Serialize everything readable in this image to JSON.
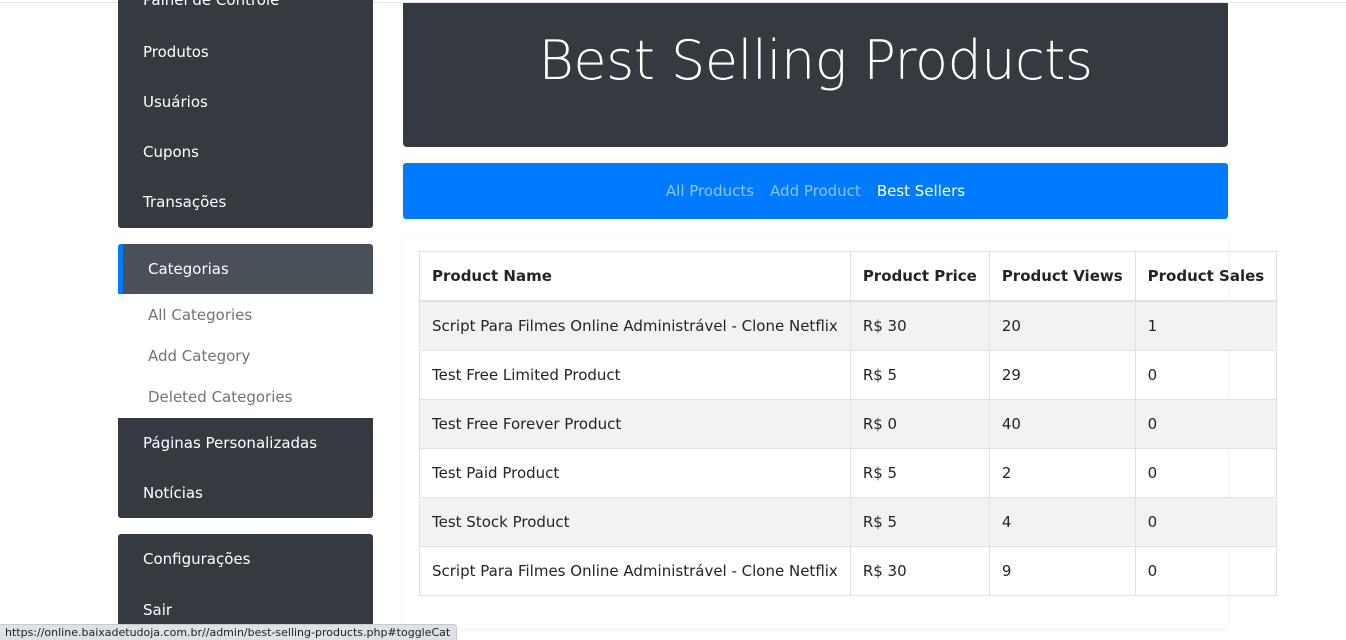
{
  "sidebar": {
    "top_items": [
      "Painel de Controle",
      "Produtos",
      "Usuários",
      "Cupons",
      "Transações"
    ],
    "active_section": "Categorias",
    "sub_items": [
      "All Categories",
      "Add Category",
      "Deleted Categories"
    ],
    "mid_items": [
      "Páginas Personalizadas",
      "Notícias"
    ],
    "bottom_items": [
      "Configurações",
      "Sair"
    ]
  },
  "header": {
    "title": "Best Selling Products"
  },
  "nav": {
    "links": [
      {
        "label": "All Products",
        "active": false
      },
      {
        "label": "Add Product",
        "active": false
      },
      {
        "label": "Best Sellers",
        "active": true
      }
    ]
  },
  "table": {
    "columns": [
      "Product Name",
      "Product Price",
      "Product Views",
      "Product Sales"
    ],
    "rows": [
      [
        "Script Para Filmes Online Administrável - Clone Netflix",
        "R$ 30",
        "20",
        "1"
      ],
      [
        "Test Free Limited Product",
        "R$ 5",
        "29",
        "0"
      ],
      [
        "Test Free Forever Product",
        "R$ 0",
        "40",
        "0"
      ],
      [
        "Test Paid Product",
        "R$ 5",
        "2",
        "0"
      ],
      [
        "Test Stock Product",
        "R$ 5",
        "4",
        "0"
      ],
      [
        "Script Para Filmes Online Administrável - Clone Netflix",
        "R$ 30",
        "9",
        "0"
      ]
    ]
  },
  "status_url": "https://online.baixadetudoja.com.br//admin/best-selling-products.php#toggleCat",
  "colors": {
    "dark": "#343a40",
    "accent": "#007bff",
    "active_bg": "#495057"
  }
}
